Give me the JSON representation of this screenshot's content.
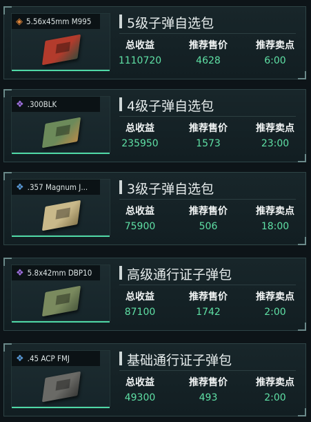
{
  "labels": {
    "total_profit": "总收益",
    "recommended_price": "推荐售价",
    "recommended_point": "推荐卖点"
  },
  "cards": [
    {
      "title": "5级子弹自选包",
      "item": {
        "name": "5.56x45mm M995",
        "icon": "orange-diamond-icon",
        "glyph": "◈",
        "glyph_color": "#e6893a",
        "box_color": "#b33b2c",
        "box_accent": "#3f4a3a"
      },
      "total_profit": "1110720",
      "recommended_price": "4628",
      "recommended_point": "6:00"
    },
    {
      "title": "4级子弹自选包",
      "item": {
        "name": ".300BLK",
        "icon": "purple-diamond-icon",
        "glyph": "❖",
        "glyph_color": "#a070e0",
        "box_color": "#6c8a5a",
        "box_accent": "#b58a4a"
      },
      "total_profit": "235950",
      "recommended_price": "1573",
      "recommended_point": "23:00"
    },
    {
      "title": "3级子弹自选包",
      "item": {
        "name": ".357 Magnum J...",
        "icon": "blue-diamond-icon",
        "glyph": "❖",
        "glyph_color": "#5a9ad8",
        "box_color": "#c9b98a",
        "box_accent": "#8a7a50"
      },
      "total_profit": "75900",
      "recommended_price": "506",
      "recommended_point": "18:00"
    },
    {
      "title": "高级通行证子弹包",
      "item": {
        "name": "5.8x42mm DBP10",
        "icon": "purple-diamond-icon",
        "glyph": "❖",
        "glyph_color": "#a070e0",
        "box_color": "#7a8a5e",
        "box_accent": "#4c5a3e"
      },
      "total_profit": "87100",
      "recommended_price": "1742",
      "recommended_point": "2:00"
    },
    {
      "title": "基础通行证子弹包",
      "item": {
        "name": ".45 ACP FMJ",
        "icon": "blue-diamond-icon",
        "glyph": "❖",
        "glyph_color": "#5a9ad8",
        "box_color": "#6a6a66",
        "box_accent": "#3a3a38"
      },
      "total_profit": "49300",
      "recommended_price": "493",
      "recommended_point": "2:00"
    }
  ]
}
